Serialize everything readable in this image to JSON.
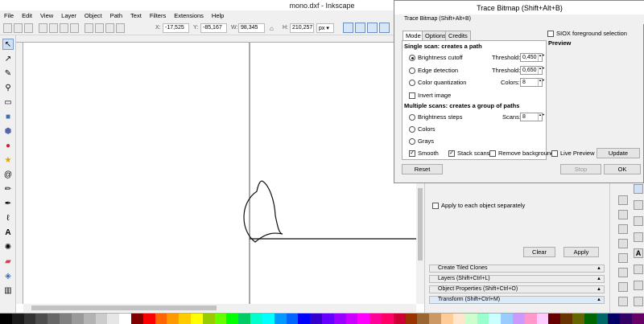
{
  "window": {
    "title": "mono.dxf - Inkscape"
  },
  "menu": [
    "File",
    "Edit",
    "View",
    "Layer",
    "Object",
    "Path",
    "Text",
    "Filters",
    "Extensions",
    "Help"
  ],
  "controls": {
    "x_label": "X:",
    "x_value": "-17,525",
    "y_label": "Y:",
    "y_value": "-85,167",
    "w_label": "W:",
    "w_value": "98,345",
    "h_label": "H:",
    "h_value": "210,257",
    "unit": "px"
  },
  "dialog": {
    "title": "Trace Bitmap (Shift+Alt+B)",
    "subtitle": "Trace Bitmap (Shift+Alt+B)",
    "tabs": [
      "Mode",
      "Options",
      "Credits"
    ],
    "single_scan_heading": "Single scan: creates a path",
    "brightness_cutoff": "Brightness cutoff",
    "edge_detection": "Edge detection",
    "color_quantization": "Color quantization",
    "invert_image": "Invert image",
    "multiple_scans_heading": "Multiple scans: creates a group of paths",
    "brightness_steps": "Brightness steps",
    "colors": "Colors",
    "grays": "Grays",
    "smooth": "Smooth",
    "stack_scans": "Stack scans",
    "remove_background": "Remove background",
    "threshold_label": "Threshold:",
    "threshold_1": "0,450",
    "threshold_2": "0,650",
    "colors_label": "Colors:",
    "colors_value": "8",
    "scans_label": "Scans:",
    "scans_value": "8",
    "siox": "SIOX foreground selection",
    "preview": "Preview",
    "live_preview": "Live Preview",
    "update": "Update",
    "reset": "Reset",
    "stop": "Stop",
    "ok": "OK"
  },
  "panel": {
    "apply_each": "Apply to each object separately",
    "clear": "Clear",
    "apply": "Apply",
    "dock": [
      "Create Tiled Clones",
      "Layers (Shift+Ctrl+L)",
      "Object Properties (Shift+Ctrl+O)",
      "Transform (Shift+Ctrl+M)"
    ]
  },
  "palette": [
    "#000000",
    "#1a1a1a",
    "#333333",
    "#4d4d4d",
    "#666666",
    "#808080",
    "#999999",
    "#b3b3b3",
    "#cccccc",
    "#e6e6e6",
    "#ffffff",
    "#800000",
    "#ff0000",
    "#ff6600",
    "#ff9900",
    "#ffcc00",
    "#ffff00",
    "#99cc00",
    "#66ff00",
    "#00ff00",
    "#00cc66",
    "#00ffcc",
    "#00ffff",
    "#0099ff",
    "#0066ff",
    "#0000ff",
    "#3300cc",
    "#6600ff",
    "#9900ff",
    "#cc00ff",
    "#ff00ff",
    "#ff0099",
    "#ff0066",
    "#cc0033",
    "#993300",
    "#996633",
    "#cc9966",
    "#ffcc99",
    "#ffe6cc",
    "#ccffcc",
    "#99ffcc",
    "#ccffff",
    "#99ccff",
    "#cc99ff",
    "#ff99cc",
    "#ffccff",
    "#660000",
    "#663300",
    "#666600",
    "#006600",
    "#006666",
    "#000066",
    "#330066",
    "#660066"
  ]
}
